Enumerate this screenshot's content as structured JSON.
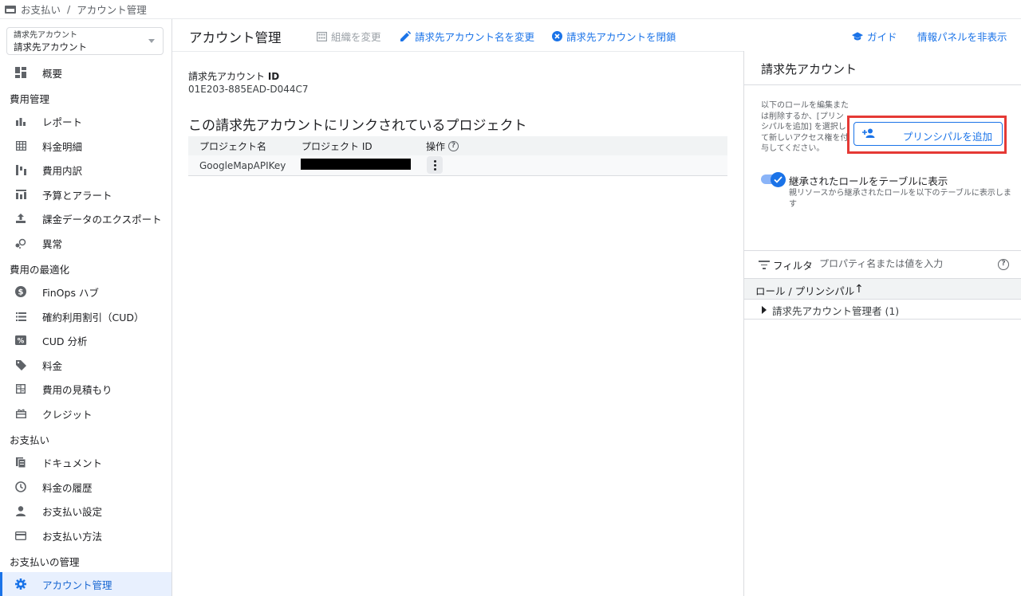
{
  "breadcrumb": {
    "root": "お支払い",
    "separator": "/",
    "current": "アカウント管理"
  },
  "sidebar": {
    "account_selector": {
      "label": "請求先アカウント",
      "value": "請求先アカウント"
    },
    "top_item": {
      "label": "概要",
      "icon": "dashboard-icon"
    },
    "sections": [
      {
        "title": "費用管理",
        "items": [
          {
            "label": "レポート",
            "icon": "bar-chart-icon"
          },
          {
            "label": "料金明細",
            "icon": "table-icon"
          },
          {
            "label": "費用内訳",
            "icon": "waterfall-chart-icon"
          },
          {
            "label": "予算とアラート",
            "icon": "budget-chart-icon"
          },
          {
            "label": "課金データのエクスポート",
            "icon": "upload-icon"
          },
          {
            "label": "異常",
            "icon": "anomaly-icon"
          }
        ]
      },
      {
        "title": "費用の最適化",
        "items": [
          {
            "label": "FinOps ハブ",
            "icon": "dollar-circle-icon"
          },
          {
            "label": "確約利用割引（CUD）",
            "icon": "list-icon"
          },
          {
            "label": "CUD 分析",
            "icon": "percent-icon"
          },
          {
            "label": "料金",
            "icon": "tag-icon"
          },
          {
            "label": "費用の見積もり",
            "icon": "calculator-icon"
          },
          {
            "label": "クレジット",
            "icon": "gift-icon"
          }
        ]
      },
      {
        "title": "お支払い",
        "items": [
          {
            "label": "ドキュメント",
            "icon": "document-icon"
          },
          {
            "label": "料金の履歴",
            "icon": "clock-icon"
          },
          {
            "label": "お支払い設定",
            "icon": "person-icon"
          },
          {
            "label": "お支払い方法",
            "icon": "credit-card-icon"
          }
        ]
      },
      {
        "title": "お支払いの管理",
        "items": [
          {
            "label": "アカウント管理",
            "icon": "gear-icon",
            "active": true
          }
        ]
      }
    ]
  },
  "header": {
    "title": "アカウント管理",
    "actions": {
      "change_org": "組織を変更",
      "rename": "請求先アカウント名を変更",
      "close": "請求先アカウントを閉鎖",
      "guide": "ガイド",
      "hide_panel": "情報パネルを非表示"
    }
  },
  "main": {
    "account_id_label": "請求先アカウント",
    "account_id_label_suffix": "ID",
    "account_id_value": "01E203-885EAD-D044C7",
    "projects_heading": "この請求先アカウントにリンクされているプロジェクト",
    "table": {
      "columns": [
        "プロジェクト名",
        "プロジェクト ID",
        "操作"
      ],
      "rows": [
        {
          "name": "GoogleMapAPIKey",
          "id": "[redacted]"
        }
      ]
    }
  },
  "info_panel": {
    "title": "請求先アカウント",
    "description": "以下のロールを編集または削除するか、[プリンシパルを追加] を選択して新しいアクセス権を付与してください。",
    "add_principal_label": "プリンシパルを追加",
    "toggle_label": "継承されたロールをテーブルに表示",
    "toggle_on": true,
    "toggle_description": "親リソースから継承されたロールを以下のテーブルに表示します",
    "filter_label": "フィルタ",
    "filter_placeholder": "プロパティ名または値を入力",
    "role_column": "ロール / プリンシパル",
    "sort_arrow": "↑",
    "role_rows": [
      "請求先アカウント管理者 (1)"
    ]
  },
  "colors": {
    "accent": "#1a73e8",
    "highlight_border": "#e53935",
    "active_nav_bg": "#e8f0fe"
  }
}
